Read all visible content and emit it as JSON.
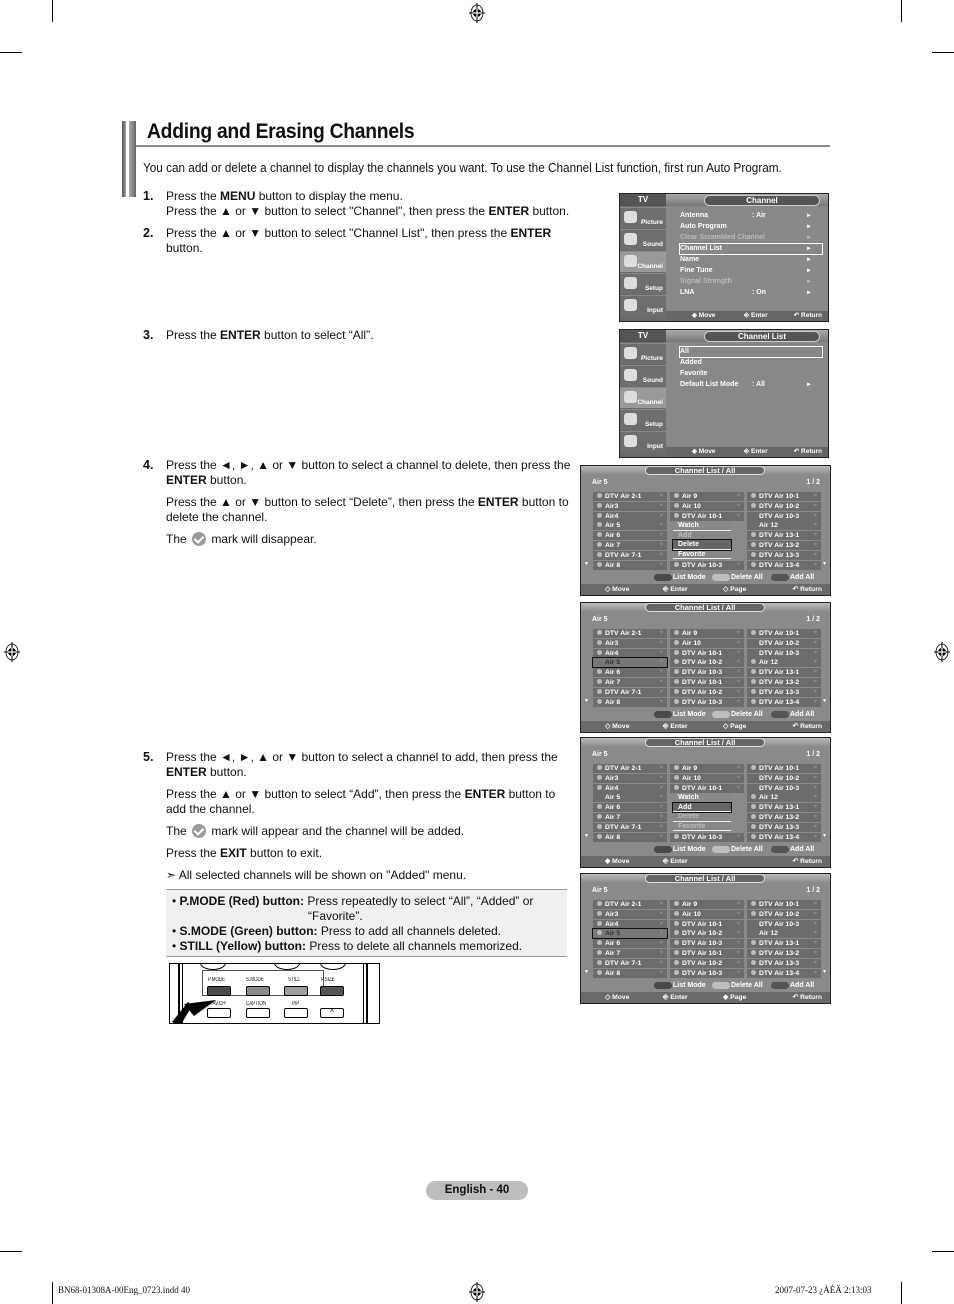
{
  "page": {
    "title": "Adding and Erasing Channels",
    "intro": "You can add or delete a channel to display the channels you want. To use the Channel List function, first run Auto Program.",
    "page_label": "English - 40",
    "slug_left": "BN68-01308A-00Eng_0723.indd   40",
    "slug_right": "2007-07-23   ¿ÀÈÄ 2:13:03"
  },
  "steps": [
    {
      "num": "1.",
      "lines": [
        {
          "pre": "Press the ",
          "bold": "MENU",
          "post": " button to display the menu."
        },
        {
          "pre": "Press the ▲ or ▼ button to select \"Channel\", then press the ",
          "bold": "ENTER",
          "post": " button."
        }
      ]
    },
    {
      "num": "2.",
      "lines": [
        {
          "pre": "Press the ▲ or ▼ button to select \"Channel List\", then press the ",
          "bold": "ENTER",
          "post": " button."
        }
      ]
    },
    {
      "num": "3.",
      "lines": [
        {
          "pre": "Press the ",
          "bold": "ENTER",
          "post": " button to select “All”."
        }
      ]
    },
    {
      "num": "4.",
      "lines": [
        {
          "pre": "Press the  ◄, ►, ▲ or ▼ button to select a channel to delete, then press the ",
          "bold": "ENTER",
          "post": " button."
        },
        {
          "pre": "Press the ▲ or ▼ button to select “Delete”, then press the ",
          "bold": "ENTER",
          "post": " button to delete the channel."
        },
        {
          "pre": "The ",
          "icon": "check-mark",
          "post": " mark will disappear."
        }
      ]
    },
    {
      "num": "5.",
      "lines": [
        {
          "pre": "Press the ◄, ►, ▲ or ▼ button to select a channel to add, then press the ",
          "bold": "ENTER",
          "post": " button."
        },
        {
          "pre": "Press the ▲ or ▼ button to select “Add”, then press the ",
          "bold": "ENTER",
          "post": " button to add the channel."
        },
        {
          "pre": "The ",
          "icon": "check-mark",
          "post": " mark will appear and the channel will be added."
        },
        {
          "pre": "Press the ",
          "bold": "EXIT",
          "post": " button to exit."
        },
        {
          "pre": "➣ All selected channels will be shown on \"Added\" menu."
        }
      ]
    }
  ],
  "notes": [
    {
      "bold": "P.MODE (Red) button:",
      "text": " Press repeatedly to select “All”, “Added” or",
      "text2": "“Favorite”."
    },
    {
      "bold": "S.MODE (Green) button:",
      "text": " Press to add all channels deleted."
    },
    {
      "bold": "STILL (Yellow) button:",
      "text": " Press to delete all channels memorized."
    }
  ],
  "remote": {
    "row1": [
      "P.MODE",
      "S.MODE",
      "STILL",
      "P.SIZE"
    ],
    "row2": [
      "FAV.CH",
      "CAPTION",
      "PIP",
      ""
    ]
  },
  "tv_side": [
    "Picture",
    "Sound",
    "Channel",
    "Setup",
    "Input"
  ],
  "menu_channel": {
    "tv": "TV",
    "header": "Channel",
    "items": [
      {
        "label": "Antenna",
        "value": ": Air",
        "arrow": "►"
      },
      {
        "label": "Auto Program",
        "value": "",
        "arrow": "►"
      },
      {
        "label": "Clear Scrambled Channel",
        "value": "",
        "arrow": "►",
        "dim": true
      },
      {
        "label": "Channel List",
        "value": "",
        "arrow": "►",
        "highlight": true
      },
      {
        "label": "Name",
        "value": "",
        "arrow": "►"
      },
      {
        "label": "Fine Tune",
        "value": "",
        "arrow": "►"
      },
      {
        "label": "Signal Strength",
        "value": "",
        "arrow": "►",
        "dim": true
      },
      {
        "label": "LNA",
        "value": ": On",
        "arrow": "►"
      }
    ],
    "footer": [
      "◆ Move",
      "⎆ Enter",
      "↶ Return"
    ]
  },
  "menu_channel_list": {
    "tv": "TV",
    "header": "Channel List",
    "items": [
      {
        "label": "All",
        "value": "",
        "arrow": "",
        "highlight": true
      },
      {
        "label": "Added",
        "value": "",
        "arrow": ""
      },
      {
        "label": "Favorite",
        "value": "",
        "arrow": ""
      },
      {
        "label": "Default List Mode",
        "value": ": All",
        "arrow": "►"
      }
    ],
    "footer": [
      "◆ Move",
      "⎆ Enter",
      "↶ Return"
    ]
  },
  "channel_screens": [
    {
      "header": "Channel List / All",
      "current": "Air 5",
      "page": "1 / 2",
      "cols": [
        [
          [
            "DTV Air 2-1",
            1
          ],
          [
            "Air3",
            1
          ],
          [
            "Air4",
            1
          ],
          [
            "Air 5",
            1
          ],
          [
            "Air 6",
            1
          ],
          [
            "Air 7",
            1
          ],
          [
            "DTV Air 7-1",
            1
          ],
          [
            "Air 8",
            1
          ]
        ],
        [
          [
            "Air 9",
            1
          ],
          [
            "Air 10",
            1
          ],
          [
            "DTV Air 10-1",
            1
          ],
          [
            "",
            0
          ],
          [
            "",
            0
          ],
          [
            "",
            0
          ],
          [
            "",
            0
          ],
          [
            "DTV Air 10-3",
            1
          ]
        ],
        [
          [
            "DTV Air 10-1",
            1
          ],
          [
            "DTV Air 10-2",
            1
          ],
          [
            "DTV Air 10-3",
            0
          ],
          [
            "Air 12",
            0
          ],
          [
            "DTV Air 13-1",
            1
          ],
          [
            "DTV Air 13-2",
            1
          ],
          [
            "DTV Air 13-3",
            1
          ],
          [
            "DTV Air 13-4",
            1
          ]
        ]
      ],
      "popup": [
        [
          "Watch",
          0
        ],
        [
          "Add",
          2
        ],
        [
          "Delete",
          1
        ],
        [
          "Favorite",
          0
        ]
      ],
      "buttons": [
        "List Mode",
        "Delete All",
        "Add All"
      ],
      "footer": [
        "◇ Move",
        "⎆ Enter",
        "◇ Page",
        "↶ Return"
      ]
    },
    {
      "header": "Channel List / All",
      "current": "Air 5",
      "page": "1 / 2",
      "cols": [
        [
          [
            "DTV Air 2-1",
            1
          ],
          [
            "Air3",
            1
          ],
          [
            "Air4",
            1
          ],
          [
            "Air 5",
            0
          ],
          [
            "Air 6",
            1
          ],
          [
            "Air 7",
            1
          ],
          [
            "DTV Air 7-1",
            1
          ],
          [
            "Air 8",
            1
          ]
        ],
        [
          [
            "Air 9",
            1
          ],
          [
            "Air 10",
            1
          ],
          [
            "DTV Air 10-1",
            1
          ],
          [
            "DTV Air 10-2",
            1
          ],
          [
            "DTV Air 10-3",
            1
          ],
          [
            "DTV Air 10-1",
            1
          ],
          [
            "DTV Air 10-2",
            1
          ],
          [
            "DTV Air 10-3",
            1
          ]
        ],
        [
          [
            "DTV Air 10-1",
            1
          ],
          [
            "DTV Air 10-2",
            0
          ],
          [
            "DTV Air 10-3",
            0
          ],
          [
            "Air 12",
            1
          ],
          [
            "DTV Air 13-1",
            1
          ],
          [
            "DTV Air 13-2",
            1
          ],
          [
            "DTV Air 13-3",
            1
          ],
          [
            "DTV Air 13-4",
            1
          ]
        ]
      ],
      "focus": 3,
      "buttons": [
        "List Mode",
        "Delete All",
        "Add All"
      ],
      "footer": [
        "◇ Move",
        "⎆ Enter",
        "◇ Page",
        "↶ Return"
      ]
    },
    {
      "header": "Channel List / All",
      "current": "Air 5",
      "page": "1 / 2",
      "cols": [
        [
          [
            "DTV Air 2-1",
            1
          ],
          [
            "Air3",
            1
          ],
          [
            "Air4",
            1
          ],
          [
            "Air 5",
            0
          ],
          [
            "Air 6",
            1
          ],
          [
            "Air 7",
            1
          ],
          [
            "DTV Air 7-1",
            1
          ],
          [
            "Air 8",
            1
          ]
        ],
        [
          [
            "Air 9",
            1
          ],
          [
            "Air 10",
            1
          ],
          [
            "DTV Air 10-1",
            1
          ],
          [
            "",
            0
          ],
          [
            "",
            0
          ],
          [
            "",
            0
          ],
          [
            "",
            0
          ],
          [
            "DTV Air 10-3",
            1
          ]
        ],
        [
          [
            "DTV Air 10-1",
            1
          ],
          [
            "DTV Air 10-2",
            0
          ],
          [
            "DTV Air 10-3",
            0
          ],
          [
            "Air 12",
            1
          ],
          [
            "DTV Air 13-1",
            1
          ],
          [
            "DTV Air 13-2",
            1
          ],
          [
            "DTV Air 13-3",
            1
          ],
          [
            "DTV Air 13-4",
            1
          ]
        ]
      ],
      "popup": [
        [
          "Watch",
          0
        ],
        [
          "Add",
          1
        ],
        [
          "Delete",
          2
        ],
        [
          "Favorite",
          2
        ]
      ],
      "buttons": [
        "List Mode",
        "Delete All",
        "Add All"
      ],
      "footer": [
        "◆ Move",
        "⎆ Enter",
        "",
        "↶ Return"
      ]
    },
    {
      "header": "Channel List / All",
      "current": "Air 5",
      "page": "1 / 2",
      "cols": [
        [
          [
            "DTV Air 2-1",
            1
          ],
          [
            "Air3",
            1
          ],
          [
            "Air4",
            1
          ],
          [
            "Air 5",
            1
          ],
          [
            "Air 6",
            1
          ],
          [
            "Air 7",
            1
          ],
          [
            "DTV Air 7-1",
            1
          ],
          [
            "Air 8",
            1
          ]
        ],
        [
          [
            "Air 9",
            1
          ],
          [
            "Air 10",
            1
          ],
          [
            "DTV Air 10-1",
            1
          ],
          [
            "DTV Air 10-2",
            1
          ],
          [
            "DTV Air 10-3",
            1
          ],
          [
            "DTV Air 10-1",
            1
          ],
          [
            "DTV Air 10-2",
            1
          ],
          [
            "DTV Air 10-3",
            1
          ]
        ],
        [
          [
            "DTV Air 10-1",
            1
          ],
          [
            "DTV Air 10-2",
            1
          ],
          [
            "DTV Air 10-3",
            0
          ],
          [
            "Air 12",
            0
          ],
          [
            "DTV Air 13-1",
            1
          ],
          [
            "DTV Air 13-2",
            1
          ],
          [
            "DTV Air 13-3",
            1
          ],
          [
            "DTV Air 13-4",
            1
          ]
        ]
      ],
      "focus": 3,
      "buttons": [
        "List Mode",
        "Delete All",
        "Add All"
      ],
      "footer": [
        "◇ Move",
        "⎆ Enter",
        "◆ Page",
        "↶ Return"
      ]
    }
  ],
  "colors": {
    "red_button": "#4a4a4a",
    "green_button": "#bdbdbd",
    "yellow_button": "#555555",
    "menu_bg": "#888888"
  }
}
